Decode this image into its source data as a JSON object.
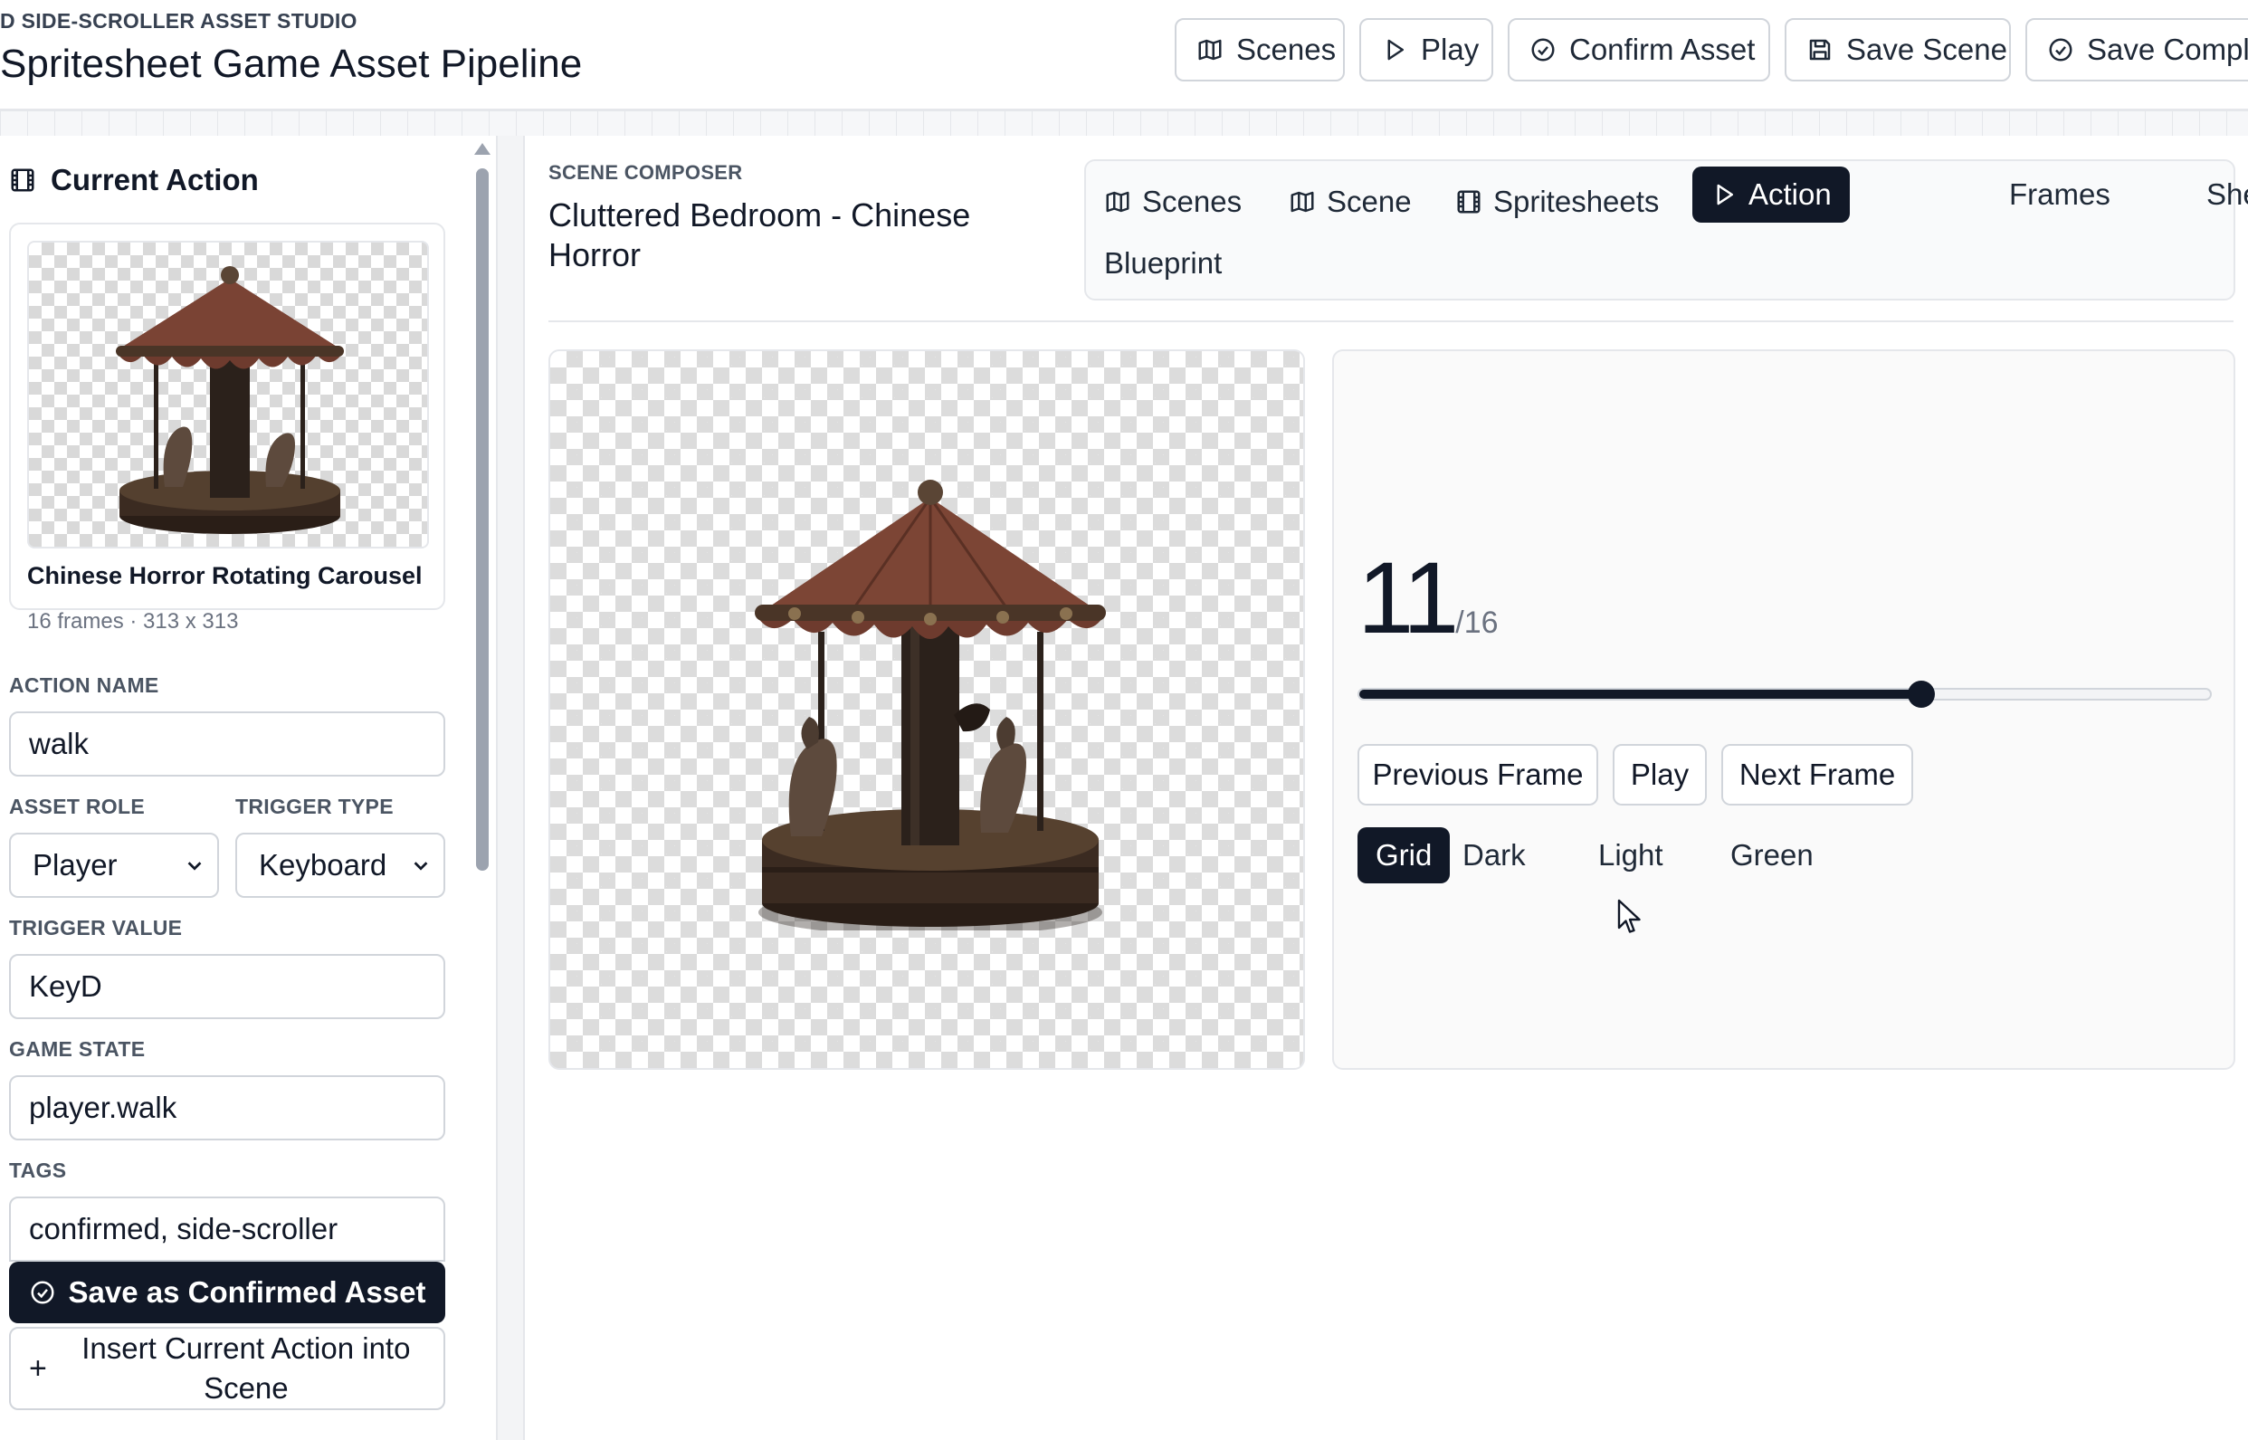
{
  "header": {
    "eyebrow": "D SIDE-SCROLLER ASSET STUDIO",
    "title": "Spritesheet Game Asset Pipeline",
    "buttons": {
      "scenes": "Scenes",
      "play": "Play",
      "confirm_asset": "Confirm Asset",
      "save_scene": "Save Scene",
      "save_complete": "Save Comple"
    }
  },
  "sidebar": {
    "heading": "Current Action",
    "asset": {
      "name": "Chinese Horror Rotating Carousel",
      "meta": "16 frames · 313 x 313"
    },
    "fields": {
      "action_name_label": "ACTION NAME",
      "action_name_value": "walk",
      "asset_role_label": "ASSET ROLE",
      "asset_role_value": "Player",
      "trigger_type_label": "TRIGGER TYPE",
      "trigger_type_value": "Keyboard",
      "trigger_value_label": "TRIGGER VALUE",
      "trigger_value_value": "KeyD",
      "game_state_label": "GAME STATE",
      "game_state_value": "player.walk",
      "tags_label": "TAGS",
      "tags_value": "confirmed, side-scroller"
    },
    "save_confirmed_label": "Save as Confirmed Asset",
    "insert_label": "Insert Current Action into Scene"
  },
  "composer": {
    "eyebrow": "SCENE COMPOSER",
    "scene_title": "Cluttered Bedroom - Chinese Horror",
    "tabs": {
      "scenes": "Scenes",
      "scene": "Scene",
      "spritesheets": "Spritesheets",
      "action": "Action",
      "frames": "Frames",
      "sheet": "Sheet",
      "blueprint": "Blueprint"
    },
    "active_tab": "Action"
  },
  "player": {
    "current_frame": "11",
    "total_frames": "/16",
    "progress": 0.66,
    "prev_label": "Previous Frame",
    "play_label": "Play",
    "next_label": "Next Frame",
    "backgrounds": {
      "grid": "Grid",
      "dark": "Dark",
      "light": "Light",
      "green": "Green"
    },
    "active_background": "Grid"
  },
  "colors": {
    "primary": "#111827",
    "border": "#d1d5db",
    "canopy": "#6e3b2e",
    "wood": "#3a2a20"
  }
}
